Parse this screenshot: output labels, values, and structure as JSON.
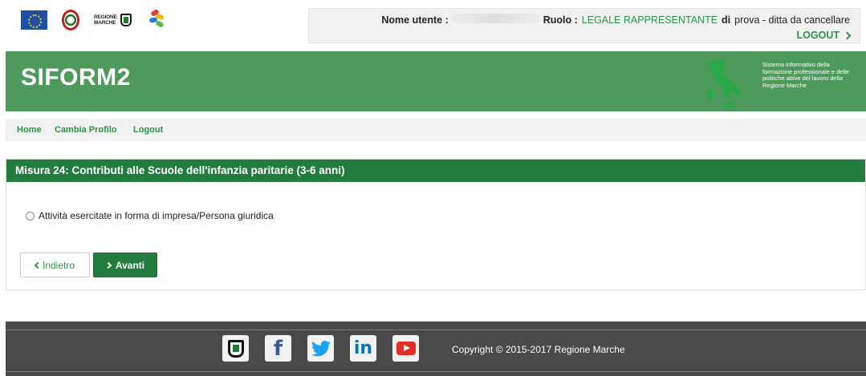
{
  "top": {
    "logos": [
      "eu-flag-logo",
      "italian-republic-emblem-logo",
      "regione-marche-logo",
      "fse-logo"
    ],
    "regione_logo_text_line1": "REGIONE",
    "regione_logo_text_line2": "MARCHE",
    "user_label": "Nome utente :",
    "user_value": "",
    "role_label": "Ruolo :",
    "role_value": "LEGALE RAPPRESENTANTE",
    "role_of": "di",
    "company": "prova - ditta da cancellare",
    "logout_label": "LOGOUT"
  },
  "header": {
    "title": "SIFORM2",
    "description": "Sistema informativo della formazione professionale e delle politiche attive del lavoro della Regione Marche"
  },
  "nav": {
    "home": "Home",
    "change_profile": "Cambia Profilo",
    "logout": "Logout"
  },
  "panel": {
    "title": "Misura 24: Contributi alle Scuole dell'infanzia paritarie (3-6 anni)",
    "option_label": "Attività esercitate in forma di impresa/Persona giuridica",
    "option_selected": false,
    "back_label": "Indietro",
    "next_label": "Avanti"
  },
  "footer": {
    "social": [
      "regione-marche-icon",
      "facebook-icon",
      "twitter-icon",
      "linkedin-icon",
      "youtube-icon"
    ],
    "facebook_glyph": "f",
    "linkedin_glyph": "in",
    "copyright": "Copyright © 2015-2017 Regione Marche"
  },
  "colors": {
    "header_green": "#4e9a5d",
    "panel_head_green": "#227c3e",
    "link_green": "#2c9246",
    "footer_gray": "#4a4a4a"
  }
}
